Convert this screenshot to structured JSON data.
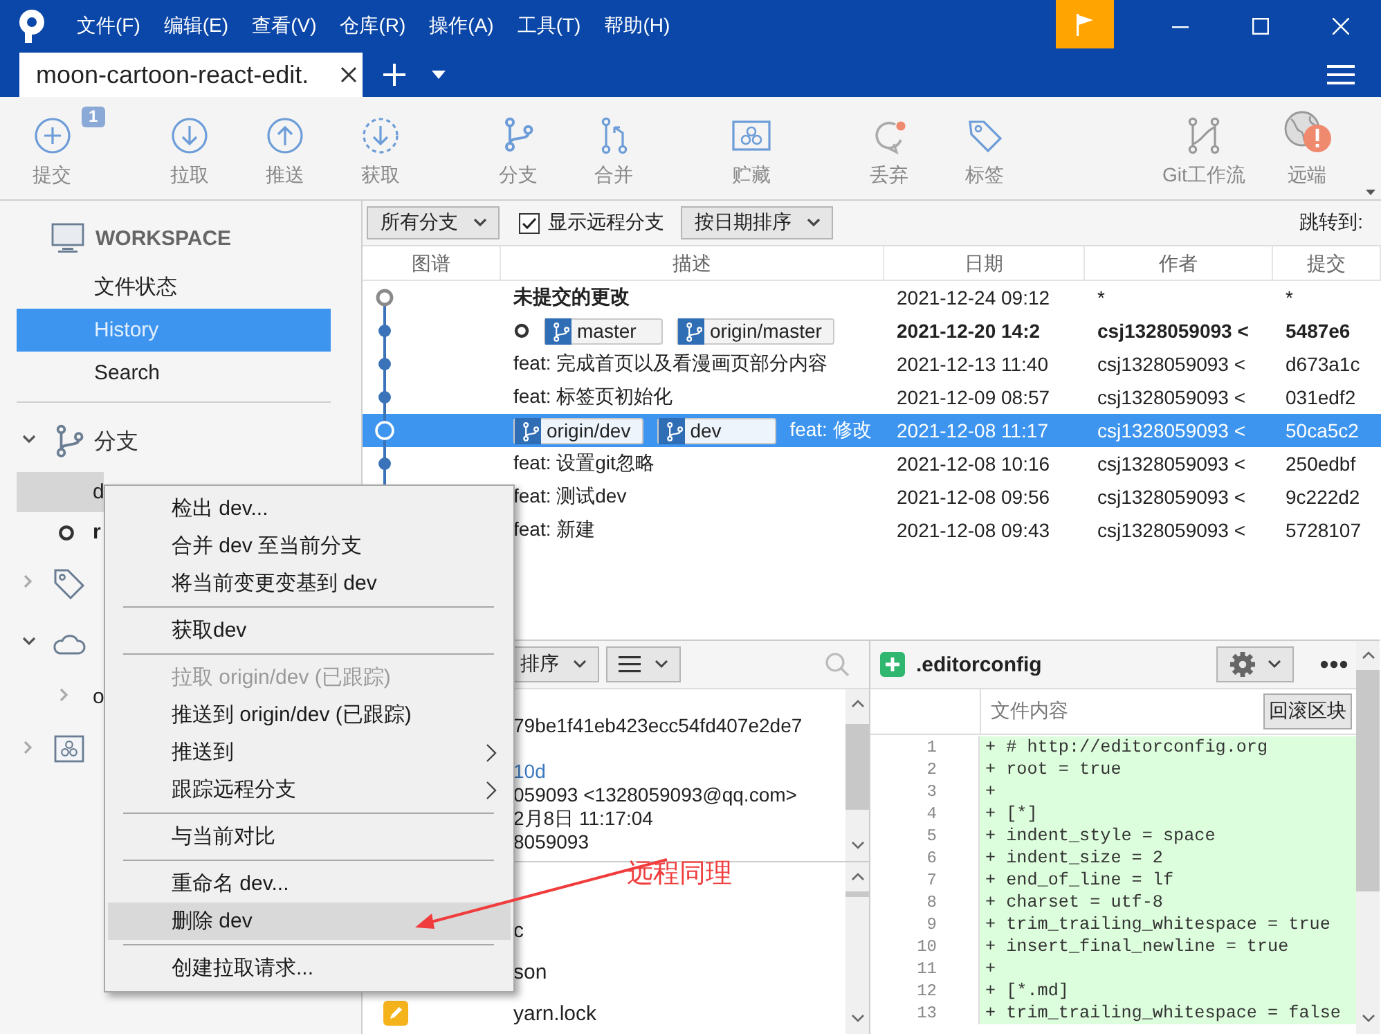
{
  "titlebar": {
    "menus": [
      "文件(F)",
      "编辑(E)",
      "查看(V)",
      "仓库(R)",
      "操作(A)",
      "工具(T)",
      "帮助(H)"
    ]
  },
  "tabs": [
    {
      "label": "moon-cartoon-react-edit.",
      "selected": true
    }
  ],
  "toolbar": {
    "groups": [
      [
        {
          "label": "提交",
          "badge": "1"
        }
      ],
      [
        {
          "label": "拉取"
        },
        {
          "label": "推送"
        },
        {
          "label": "获取"
        }
      ],
      [
        {
          "label": "分支"
        },
        {
          "label": "合并"
        }
      ],
      [
        {
          "label": "贮藏"
        }
      ],
      [
        {
          "label": "丢弃"
        },
        {
          "label": "标签"
        }
      ],
      [
        {
          "label": "Git工作流"
        },
        {
          "label": "远端"
        }
      ]
    ]
  },
  "sidebar": {
    "workspace": {
      "title": "WORKSPACE",
      "items": [
        {
          "label": "文件状态",
          "selected": false
        },
        {
          "label": "History",
          "selected": true
        },
        {
          "label": "Search",
          "selected": false
        }
      ]
    },
    "sections": [
      {
        "label": "分支",
        "expanded": true,
        "children": [
          {
            "label": "d",
            "selected": true,
            "current": false
          },
          {
            "label": "r",
            "selected": false,
            "current": true
          }
        ]
      },
      {
        "expanded": false
      },
      {
        "expanded": true,
        "children": [
          {
            "label": "o",
            "expanded": false
          }
        ]
      },
      {
        "expanded": false
      }
    ]
  },
  "filter_bar": {
    "branch_filter": "所有分支",
    "show_remote": {
      "label": "显示远程分支",
      "checked": true
    },
    "sort": "按日期排序",
    "jump_label": "跳转到:"
  },
  "commits": {
    "columns": [
      "图谱",
      "描述",
      "日期",
      "作者",
      "提交"
    ],
    "rows": [
      {
        "kind": "uncommitted",
        "description": "未提交的更改",
        "bold_description": true,
        "bold": false,
        "head": false,
        "refs": [],
        "date": "2021-12-24 09:12",
        "author": "*",
        "commit": "*",
        "selected": false
      },
      {
        "kind": "commit",
        "bold": true,
        "head": true,
        "refs": [
          "master",
          "origin/master"
        ],
        "date": "2021-12-20 14:2",
        "author": "csj1328059093 <",
        "commit": "5487e6",
        "selected": false
      },
      {
        "kind": "commit",
        "description": "feat: 完成首页以及看漫画页部分内容",
        "bold_description": false,
        "bold": false,
        "head": false,
        "refs": [],
        "date": "2021-12-13 11:40",
        "author": "csj1328059093 <",
        "commit": "d673a1c",
        "selected": false
      },
      {
        "kind": "commit",
        "description": "feat: 标签页初始化",
        "bold_description": false,
        "bold": false,
        "head": false,
        "refs": [],
        "date": "2021-12-09 08:57",
        "author": "csj1328059093 <",
        "commit": "031edf2",
        "selected": false
      },
      {
        "kind": "commit",
        "description": "feat: 修改",
        "bold_description": false,
        "bold": false,
        "head": false,
        "refs": [
          "origin/dev",
          "dev"
        ],
        "date": "2021-12-08 11:17",
        "author": "csj1328059093 <",
        "commit": "50ca5c2",
        "selected": true
      },
      {
        "kind": "commit",
        "description": "feat: 设置git忽略",
        "bold_description": false,
        "bold": false,
        "head": false,
        "refs": [],
        "date": "2021-12-08 10:16",
        "author": "csj1328059093 <",
        "commit": "250edbf",
        "selected": false
      },
      {
        "kind": "commit",
        "description": "feat: 测试dev",
        "bold_description": false,
        "bold": false,
        "head": false,
        "refs": [],
        "date": "2021-12-08 09:56",
        "author": "csj1328059093 <",
        "commit": "9c222d2",
        "selected": false
      },
      {
        "description": "feat: 新建",
        "bold_description": false,
        "bold": false,
        "head": false,
        "refs": [],
        "date": "2021-12-08 09:43",
        "author": "csj1328059093 <",
        "commit": "5728107",
        "selected": false
      }
    ]
  },
  "details": {
    "sort": "排序",
    "lines": [
      {
        "text": "79be1f41eb423ecc54fd407e2de7",
        "kind": "text",
        "gap_before": false
      },
      {
        "text": "10d",
        "kind": "link",
        "gap_before": true
      },
      {
        "text": "059093 <1328059093@qq.com>",
        "kind": "text",
        "gap_before": false
      },
      {
        "text": "2月8日 11:17:04",
        "kind": "text",
        "gap_before": false
      },
      {
        "text": "8059093",
        "kind": "text",
        "gap_before": false
      }
    ],
    "files": [
      {
        "name": "c"
      },
      {
        "name": "son"
      },
      {
        "name": "yarn.lock",
        "kind": "modified"
      }
    ]
  },
  "diff": {
    "file": ".editorconfig",
    "kind": "added",
    "column_label": "文件内容",
    "revert_button": "回滚区块",
    "lines": [
      {
        "number": "1",
        "text": "+ # http://editorconfig.org"
      },
      {
        "number": "2",
        "text": "+ root = true"
      },
      {
        "number": "3",
        "text": "+"
      },
      {
        "number": "4",
        "text": "+ [*]"
      },
      {
        "number": "5",
        "text": "+ indent_style = space"
      },
      {
        "number": "6",
        "text": "+ indent_size = 2"
      },
      {
        "number": "7",
        "text": "+ end_of_line = lf"
      },
      {
        "number": "8",
        "text": "+ charset = utf-8"
      },
      {
        "number": "9",
        "text": "+ trim_trailing_whitespace = true"
      },
      {
        "number": "10",
        "text": "+ insert_final_newline = true"
      },
      {
        "number": "11",
        "text": "+"
      },
      {
        "number": "12",
        "text": "+ [*.md]"
      },
      {
        "number": "13",
        "text": "+ trim_trailing_whitespace = false"
      }
    ]
  },
  "context_menu": {
    "items": [
      {
        "kind": "item",
        "label": "检出 dev...",
        "disabled": false,
        "highlighted": false,
        "submenu": false
      },
      {
        "kind": "item",
        "label": "合并 dev 至当前分支",
        "disabled": false,
        "highlighted": false,
        "submenu": false
      },
      {
        "kind": "item",
        "label": "将当前变更变基到 dev",
        "disabled": false,
        "highlighted": false,
        "submenu": false
      },
      {
        "kind": "separator"
      },
      {
        "kind": "item",
        "label": "获取dev",
        "disabled": false,
        "highlighted": false,
        "submenu": false
      },
      {
        "kind": "separator"
      },
      {
        "kind": "item",
        "label": "拉取 origin/dev (已跟踪)",
        "disabled": true,
        "highlighted": false,
        "submenu": false
      },
      {
        "kind": "item",
        "label": "推送到 origin/dev (已跟踪)",
        "disabled": false,
        "highlighted": false,
        "submenu": false
      },
      {
        "kind": "item",
        "label": "推送到",
        "disabled": false,
        "highlighted": false,
        "submenu": true
      },
      {
        "kind": "item",
        "label": "跟踪远程分支",
        "disabled": false,
        "highlighted": false,
        "submenu": true
      },
      {
        "kind": "separator"
      },
      {
        "kind": "item",
        "label": "与当前对比",
        "disabled": false,
        "highlighted": false,
        "submenu": false
      },
      {
        "kind": "separator"
      },
      {
        "kind": "item",
        "label": "重命名 dev...",
        "disabled": false,
        "highlighted": false,
        "submenu": false
      },
      {
        "kind": "item",
        "label": "删除 dev",
        "disabled": false,
        "highlighted": true,
        "submenu": false
      },
      {
        "kind": "separator"
      },
      {
        "kind": "item",
        "label": "创建拉取请求...",
        "disabled": false,
        "highlighted": false,
        "submenu": false
      }
    ]
  },
  "annotation": {
    "text": "远程同理"
  }
}
